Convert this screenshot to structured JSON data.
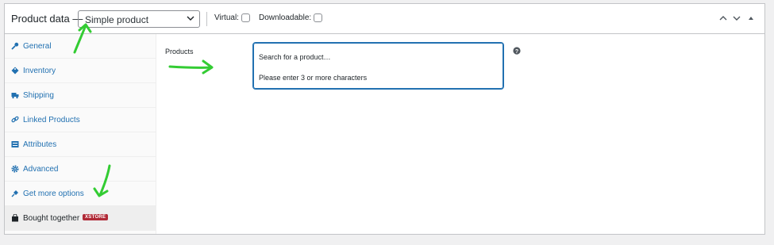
{
  "header": {
    "title": "Product data —",
    "product_type": "Simple product",
    "virtual_label": "Virtual:",
    "downloadable_label": "Downloadable:"
  },
  "tabs": [
    {
      "label": "General",
      "icon": "wrench-icon"
    },
    {
      "label": "Inventory",
      "icon": "tag-icon"
    },
    {
      "label": "Shipping",
      "icon": "truck-icon"
    },
    {
      "label": "Linked Products",
      "icon": "link-icon"
    },
    {
      "label": "Attributes",
      "icon": "list-icon"
    },
    {
      "label": "Advanced",
      "icon": "gear-icon"
    },
    {
      "label": "Get more options",
      "icon": "plugin-icon"
    },
    {
      "label": "Bought together",
      "icon": "bag-icon",
      "badge": "XSTORE",
      "active": true
    }
  ],
  "main": {
    "field_label": "Products",
    "search_placeholder": "Search for a product…",
    "search_message": "Please enter 3 or more characters"
  },
  "colors": {
    "accent": "#2271b1",
    "badge": "#b02a37",
    "annotation": "#33cc33"
  }
}
